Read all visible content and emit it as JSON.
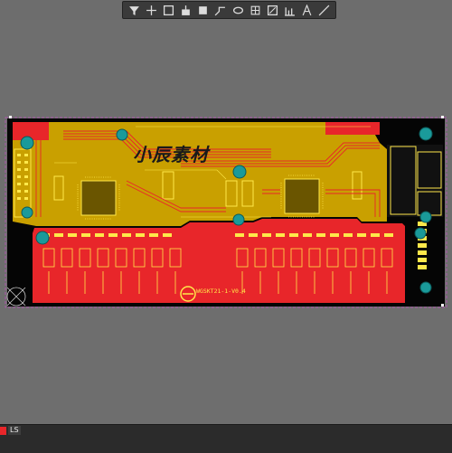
{
  "toolbar": {
    "tools": [
      {
        "name": "filter-icon"
      },
      {
        "name": "crosshair-icon"
      },
      {
        "name": "select-rect-icon"
      },
      {
        "name": "place-component-icon"
      },
      {
        "name": "fill-square-icon"
      },
      {
        "name": "route-track-icon"
      },
      {
        "name": "via-icon"
      },
      {
        "name": "grid-icon"
      },
      {
        "name": "polygon-icon"
      },
      {
        "name": "bar-chart-icon"
      },
      {
        "name": "text-icon"
      },
      {
        "name": "line-icon"
      }
    ]
  },
  "board": {
    "watermark_text": "小辰素材",
    "silk_label": "WGSKT21-1-V0.4",
    "colors": {
      "top_copper": "#e8262a",
      "bottom_copper": "#c8a000",
      "silk": "#ffe84a",
      "via": "#1a9a9a",
      "board_bg": "#000000"
    }
  },
  "status": {
    "layer_name": "LS",
    "layer_color": "#e8262a"
  }
}
